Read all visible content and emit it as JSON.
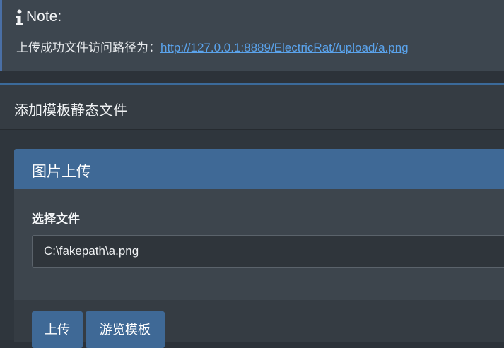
{
  "note": {
    "title": "Note:",
    "message": "上传成功文件访问路径为：",
    "link_text": "http://127.0.0.1:8889/ElectricRat//upload/a.png"
  },
  "panel": {
    "title": "添加模板静态文件"
  },
  "card": {
    "title": "图片上传",
    "file_label": "选择文件",
    "file_value": "C:\\fakepath\\a.png"
  },
  "buttons": {
    "upload": "上传",
    "browse_templates": "游览模板"
  },
  "colors": {
    "accent": "#3f6996",
    "link": "#5aa3ec",
    "background": "#2c3239"
  }
}
